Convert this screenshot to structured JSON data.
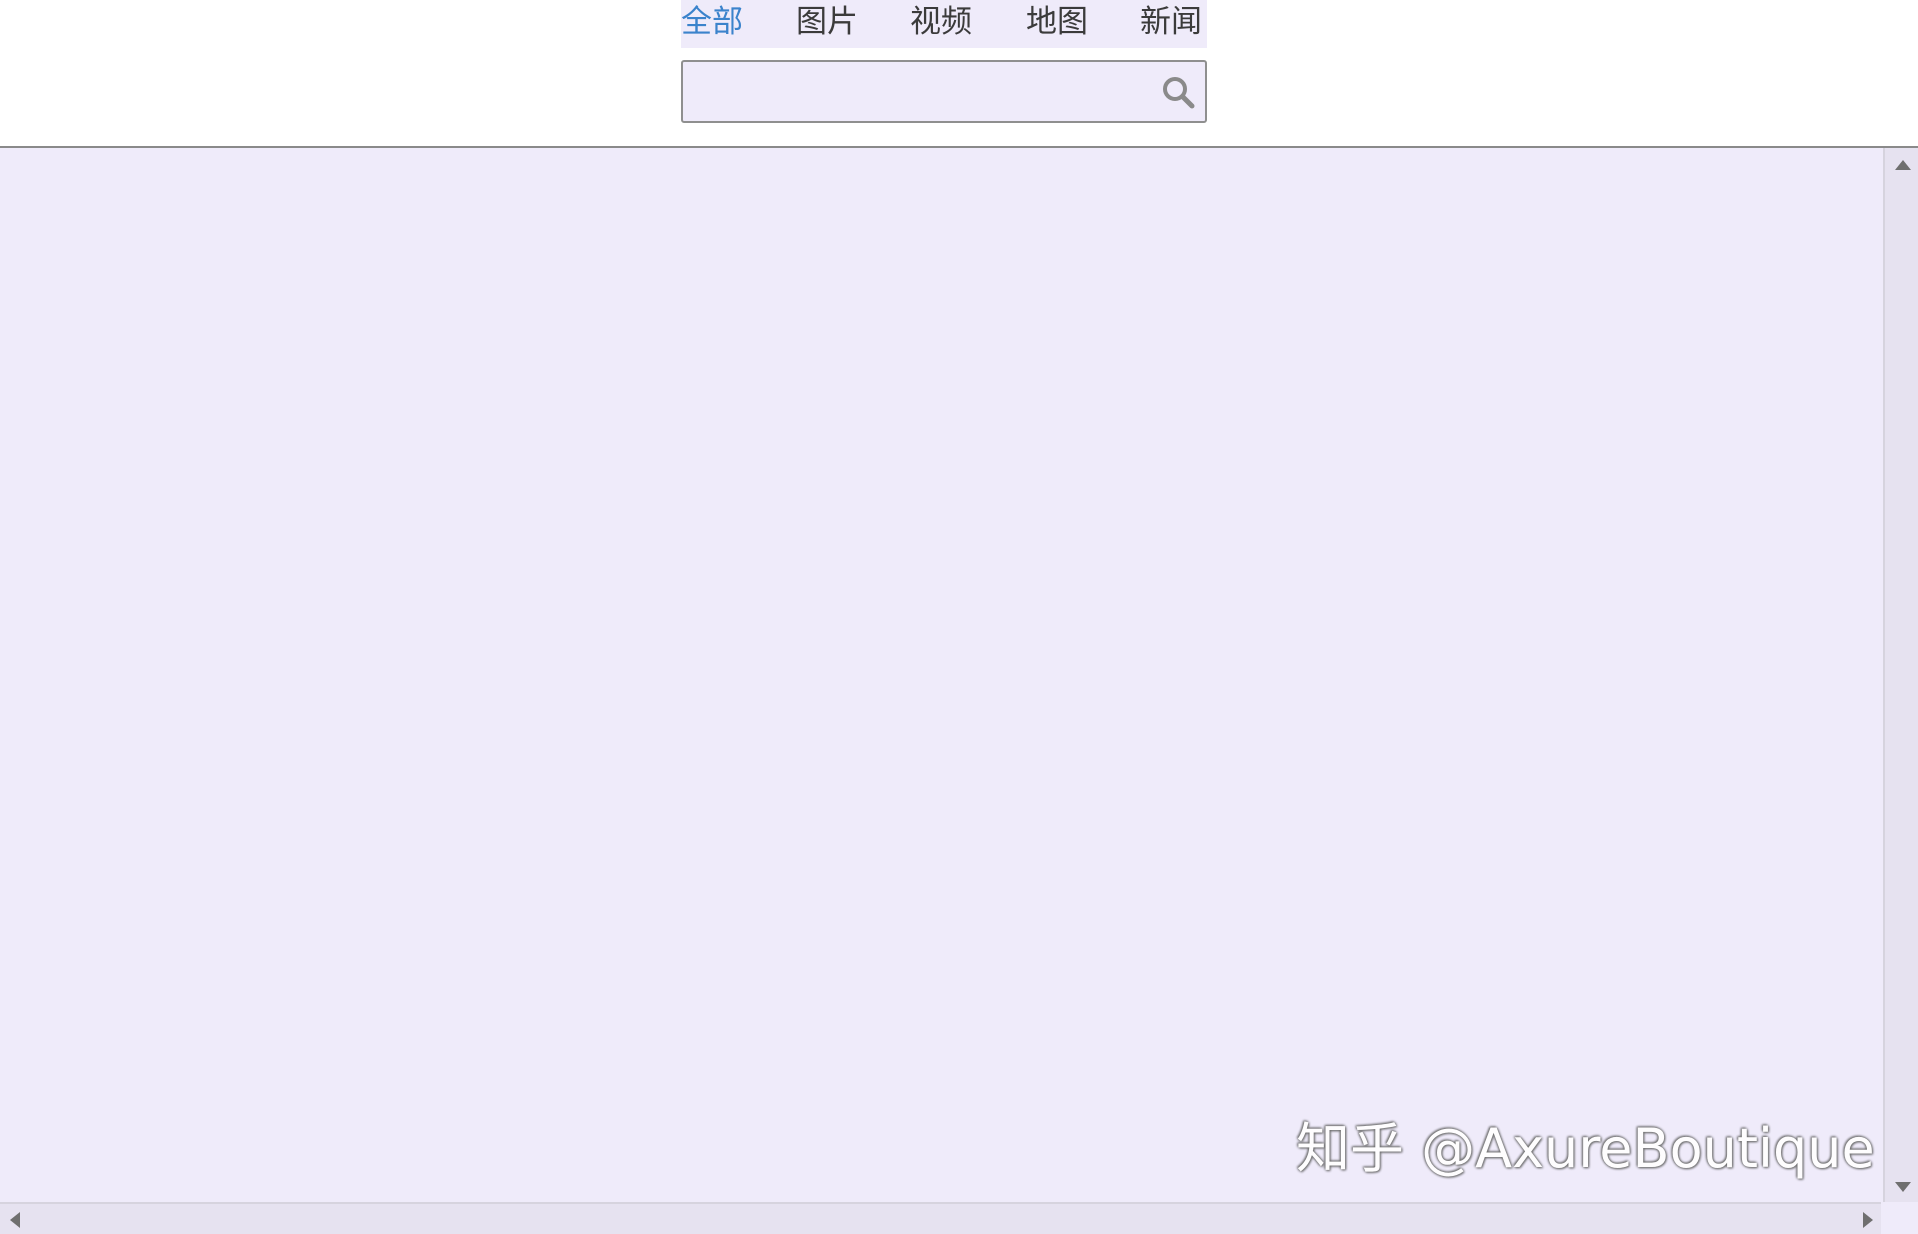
{
  "tabs": [
    {
      "label": "全部",
      "active": true
    },
    {
      "label": "图片",
      "active": false
    },
    {
      "label": "视频",
      "active": false
    },
    {
      "label": "地图",
      "active": false
    },
    {
      "label": "新闻",
      "active": false
    }
  ],
  "search": {
    "value": "",
    "placeholder": "",
    "icon": "search-icon"
  },
  "watermark": {
    "text": "知乎 @AxureBoutique"
  },
  "colors": {
    "active_tab": "#3b83cc",
    "tab_text": "#3b3b3b",
    "panel_background": "#efebfa",
    "border": "#8f8f8f"
  }
}
